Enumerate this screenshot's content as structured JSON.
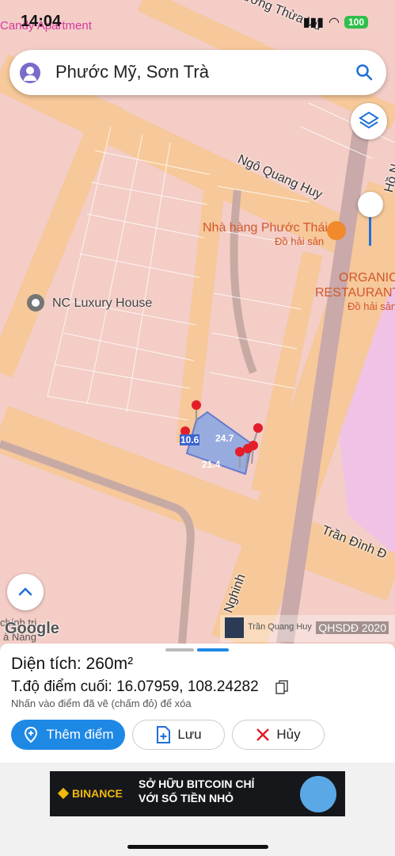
{
  "status_bar": {
    "time": "14:04",
    "overlay_label": "Candy Apartment",
    "battery": "100"
  },
  "search": {
    "query": "Phước Mỹ, Sơn Trà"
  },
  "map": {
    "streets": [
      "Vương Thừa Vũ",
      "Ngô Quang Huy",
      "Trần Đình Đ",
      "Nghinh",
      "Hồ N"
    ],
    "pois": [
      {
        "name": "Nhà hàng Phước Thái",
        "category": "Đồ hải sản"
      },
      {
        "name": "ORGANIC",
        "name2": "RESTAURANT",
        "category": "Đồ hải sản"
      },
      {
        "name": "NC Luxury House"
      }
    ],
    "partial_labels": [
      "chính trị",
      "à Nẵng"
    ],
    "measurements": [
      "10.6",
      "24.7",
      "21.4"
    ],
    "attribution_name": "Trần Quang Huy",
    "attribution_tag": "QHSDĐ 2020",
    "google_logo": "Google"
  },
  "panel": {
    "area_label": "Diện tích: 260m²",
    "coord_label": "T.độ điểm cuối: 16.07959, 108.24282",
    "hint": "Nhấn vào điểm đã vẽ (chấm đỏ) để xóa",
    "buttons": {
      "add": "Thêm điểm",
      "save": "Lưu",
      "cancel": "Hủy"
    }
  },
  "ad": {
    "brand": "BINANCE",
    "line1": "SỞ HỮU BITCOIN CHỈ",
    "line2": "VỚI SỐ TIỀN NHỎ"
  },
  "colors": {
    "accent": "#1e88e5",
    "marker": "#e31d2a",
    "poi": "#d2572a"
  }
}
